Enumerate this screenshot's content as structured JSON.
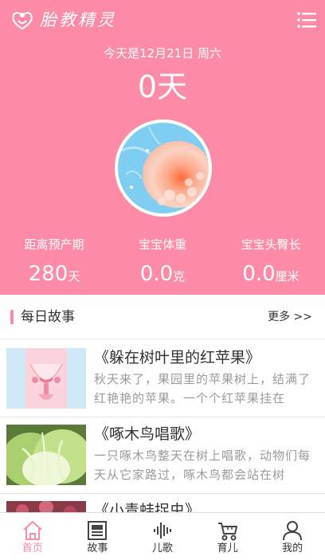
{
  "header": {
    "app_title": "胎教精灵"
  },
  "hero": {
    "date_text": "今天是12月21日 周六",
    "days_text": "0天",
    "stats": [
      {
        "label": "距离预产期",
        "value": "280",
        "unit": "天"
      },
      {
        "label": "宝宝体重",
        "value": "0.0",
        "unit": "克"
      },
      {
        "label": "宝宝头臀长",
        "value": "0.0",
        "unit": "厘米"
      }
    ]
  },
  "section": {
    "title": "每日故事",
    "more": "更多 >>"
  },
  "stories": [
    {
      "title": "《躲在树叶里的红苹果》",
      "desc": "秋天来了，果园里的苹果树上，结满了红艳艳的苹果。一个个红苹果挂在"
    },
    {
      "title": "《啄木鸟唱歌》",
      "desc": "一只啄木鸟整天在树上唱歌，动物们每天从它家路过，啄木鸟都会站在树"
    },
    {
      "title": "《小青蛙捉虫》",
      "desc": ""
    }
  ],
  "tabs": [
    {
      "label": "首页",
      "icon": "home-icon",
      "active": true
    },
    {
      "label": "故事",
      "icon": "newspaper-icon",
      "active": false
    },
    {
      "label": "儿歌",
      "icon": "soundwave-icon",
      "active": false
    },
    {
      "label": "育儿",
      "icon": "stroller-icon",
      "active": false
    },
    {
      "label": "我的",
      "icon": "user-icon",
      "active": false
    }
  ],
  "colors": {
    "accent": "#fd8aa6",
    "text": "#333333",
    "muted": "#9a9a9a"
  }
}
